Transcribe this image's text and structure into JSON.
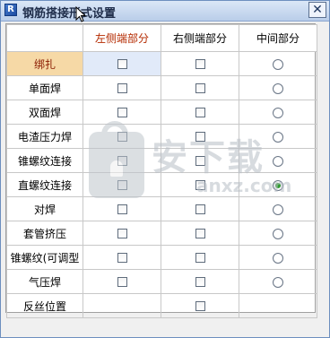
{
  "window": {
    "title": "钢筋搭接形式设置",
    "close_label": "✕"
  },
  "columns": [
    "左侧端部分",
    "右侧端部分",
    "中间部分"
  ],
  "rows": [
    {
      "label": "绑扎",
      "left": "checkbox",
      "right": "checkbox",
      "middle": "radio",
      "middle_checked": false,
      "active": true
    },
    {
      "label": "单面焊",
      "left": "checkbox",
      "right": "checkbox",
      "middle": "radio",
      "middle_checked": false
    },
    {
      "label": "双面焊",
      "left": "checkbox",
      "right": "checkbox",
      "middle": "radio",
      "middle_checked": false
    },
    {
      "label": "电渣压力焊",
      "left": "checkbox",
      "right": "checkbox",
      "middle": "radio",
      "middle_checked": false
    },
    {
      "label": "锥螺纹连接",
      "left": "checkbox",
      "right": "checkbox",
      "middle": "radio",
      "middle_checked": false
    },
    {
      "label": "直螺纹连接",
      "left": "checkbox",
      "right": "checkbox",
      "middle": "radio",
      "middle_checked": true
    },
    {
      "label": "对焊",
      "left": "checkbox",
      "right": "checkbox",
      "middle": "radio",
      "middle_checked": false
    },
    {
      "label": "套管挤压",
      "left": "checkbox",
      "right": "checkbox",
      "middle": "radio",
      "middle_checked": false
    },
    {
      "label": "锥螺纹(可调型",
      "left": "checkbox",
      "right": "checkbox",
      "middle": "radio",
      "middle_checked": false
    },
    {
      "label": "气压焊",
      "left": "checkbox",
      "right": "checkbox",
      "middle": "radio",
      "middle_checked": false
    },
    {
      "label": "反丝位置",
      "left": "none",
      "right": "checkbox",
      "middle": "none",
      "middle_checked": false
    }
  ],
  "watermark": {
    "text": "安下载",
    "sub": "anxz.com"
  },
  "colors": {
    "active_header": "#f6d9a6",
    "radio_checked": "#2e9a2e",
    "title_bar": "#c6d7ef"
  }
}
